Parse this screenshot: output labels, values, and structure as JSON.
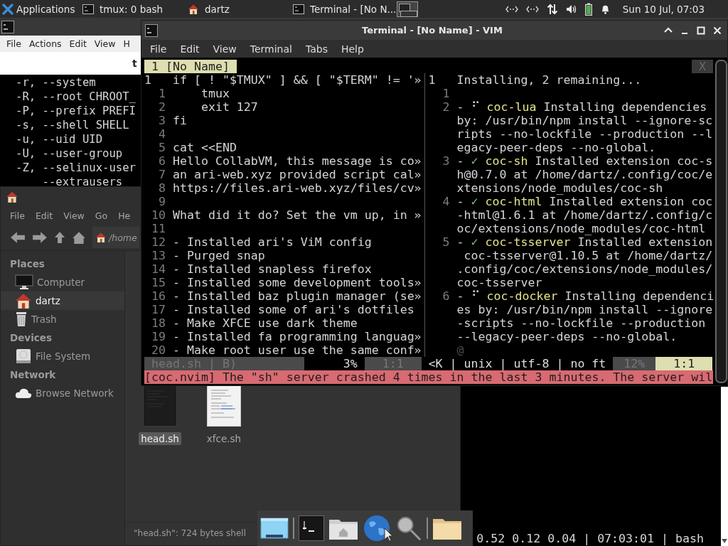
{
  "panel": {
    "apps_label": "Applications",
    "tasks": [
      {
        "kind": "terminal",
        "label": "tmux: 0 bash"
      },
      {
        "kind": "home",
        "label": "dartz"
      },
      {
        "kind": "terminal",
        "label": "Terminal - [No N..."
      }
    ],
    "clock": "Sun 10 Jul, 07:03"
  },
  "tmux_window": {
    "menu": [
      "File",
      "Actions",
      "Edit",
      "View",
      "H"
    ],
    "tab_title": "t",
    "lines": [
      "-r, --system",
      "-R, --root CHROOT_",
      "-P, --prefix PREFI",
      "-s, --shell SHELL",
      "-u, --uid UID",
      "-U, --user-group",
      "-Z, --selinux-user",
      "    --extrausers"
    ],
    "status": "0.52 0.12 0.04 | 07:03:01 | bash"
  },
  "file_manager": {
    "menu": [
      "File",
      "Edit",
      "View",
      "Go",
      "He"
    ],
    "location": "/home",
    "sidebar": [
      {
        "heading": "Places",
        "items": [
          {
            "kind": "computer",
            "label": "Computer",
            "selected": false
          },
          {
            "kind": "home",
            "label": "dartz",
            "selected": true
          },
          {
            "kind": "trash",
            "label": "Trash",
            "selected": false
          }
        ]
      },
      {
        "heading": "Devices",
        "items": [
          {
            "kind": "drive",
            "label": "File System",
            "selected": false
          }
        ]
      },
      {
        "heading": "Network",
        "items": [
          {
            "kind": "cloud",
            "label": "Browse Network",
            "selected": false
          }
        ]
      }
    ],
    "files": [
      {
        "kind": "dark",
        "name": "head.sh",
        "selected": true
      },
      {
        "kind": "light",
        "name": "xfce.sh",
        "selected": false
      }
    ],
    "status": "\"head.sh\": 724 bytes shell"
  },
  "vim_window": {
    "title": "Terminal - [No Name] - VIM",
    "menu": [
      "File",
      "Edit",
      "View",
      "Terminal",
      "Tabs",
      "Help"
    ],
    "tabline": {
      "tab": "1 [No Name]",
      "close": "X"
    },
    "left_pane": {
      "current": {
        "num": "1",
        "text": "if [ ! \"$TMUX\" ] && [ \"$TERM\" != '»"
      },
      "lines": [
        {
          "num": "1",
          "text": "    tmux"
        },
        {
          "num": "2",
          "text": "    exit 127"
        },
        {
          "num": "3",
          "text": "fi"
        },
        {
          "num": "4"
        },
        {
          "num": "5",
          "text": "cat <<END"
        },
        {
          "num": "6",
          "text": "Hello CollabVM, this message is co»"
        },
        {
          "num": "7",
          "text": "an ari-web.xyz provided script cal»"
        },
        {
          "num": "8",
          "text": "https://files.ari-web.xyz/files/cv»"
        },
        {
          "num": "9"
        },
        {
          "num": "10",
          "text": "What did it do? Set the vm up, in »"
        },
        {
          "num": "11"
        },
        {
          "num": "12",
          "text": "- Installed ari's ViM config"
        },
        {
          "num": "13",
          "text": "- Purged snap"
        },
        {
          "num": "14",
          "text": "- Installed snapless firefox"
        },
        {
          "num": "15",
          "text": "- Installed some development tools»"
        },
        {
          "num": "16",
          "text": "- Installed baz plugin manager (se»"
        },
        {
          "num": "17",
          "text": "- Installed some of ari's dotfiles"
        },
        {
          "num": "18",
          "text": "- Make XFCE use dark theme"
        },
        {
          "num": "19",
          "text": "- Installed fa programming languag»"
        },
        {
          "num": "20",
          "text": "- Make root user use the same conf»"
        }
      ]
    },
    "right_pane": {
      "current": {
        "num": "1",
        "text": "Installing, 2 remaining..."
      },
      "rows": [
        {
          "kind": "blank",
          "num": "1"
        },
        {
          "kind": "item",
          "num": "2",
          "lead": "-",
          "icon": "⠋",
          "done": false,
          "name": "coc-lua",
          "rest": "Installing dependencies"
        },
        {
          "kind": "wrap",
          "text": "by: /usr/bin/npm install --ignore-sc"
        },
        {
          "kind": "wrap",
          "text": "ripts --no-lockfile --production --l"
        },
        {
          "kind": "wrap",
          "text": "egacy-peer-deps --no-global."
        },
        {
          "kind": "item",
          "num": "3",
          "lead": "-",
          "icon": "✓",
          "done": true,
          "name": "coc-sh",
          "rest": "Installed extension coc-s"
        },
        {
          "kind": "wrap",
          "text": "h@0.7.0 at /home/dartz/.config/coc/e"
        },
        {
          "kind": "wrap",
          "text": "xtensions/node_modules/coc-sh"
        },
        {
          "kind": "item",
          "num": "4",
          "lead": "-",
          "icon": "✓",
          "done": true,
          "name": "coc-html",
          "rest": "Installed extension coc"
        },
        {
          "kind": "wrap",
          "text": "-html@1.6.1 at /home/dartz/.config/c"
        },
        {
          "kind": "wrap",
          "text": "oc/extensions/node_modules/coc-html"
        },
        {
          "kind": "item",
          "num": "5",
          "lead": "-",
          "icon": "✓",
          "done": true,
          "name": "coc-tsserver",
          "rest": "Installed extension"
        },
        {
          "kind": "wrap",
          "text": " coc-tsserver@1.10.5 at /home/dartz/"
        },
        {
          "kind": "wrap",
          "text": ".config/coc/extensions/node_modules/"
        },
        {
          "kind": "wrap",
          "text": "coc-tsserver"
        },
        {
          "kind": "item",
          "num": "6",
          "lead": "-",
          "icon": "⠋",
          "done": false,
          "name": "coc-docker",
          "rest": "Installing dependenci"
        },
        {
          "kind": "wrap",
          "text": "es by: /usr/bin/npm install --ignore"
        },
        {
          "kind": "wrap",
          "text": "-scripts --no-lockfile --production"
        },
        {
          "kind": "wrap",
          "text": "--legacy-peer-deps --no-global."
        },
        {
          "kind": "end",
          "text": "@"
        }
      ]
    },
    "statusline": {
      "file": "head.sh | B)",
      "percent": "3%",
      "pos": "1:1",
      "info": "<K | unix | utf-8 | no ft",
      "percent2": "12%",
      "pos2": "1:1"
    },
    "message": "[coc.nvim] The \"sh\" server crashed 4 times in the last 3 minutes. The server wil"
  }
}
